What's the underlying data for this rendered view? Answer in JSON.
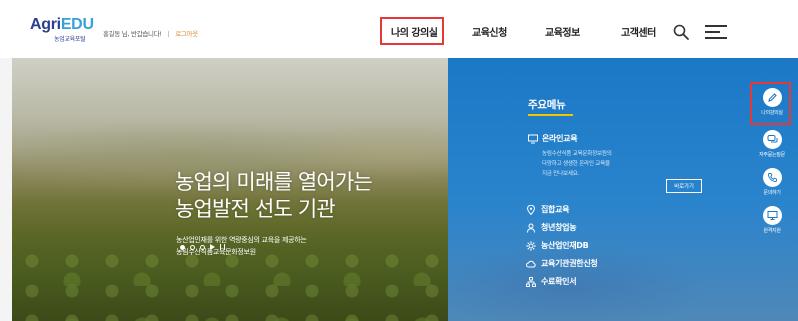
{
  "header": {
    "logo_main_a": "Agri",
    "logo_main_b": "EDU",
    "logo_sub": "농업교육포털",
    "greeting": "홍길동 님, 반갑습니다!",
    "separator": "|",
    "logout": "로그아웃"
  },
  "nav": {
    "items": [
      "나의 강의실",
      "교육신청",
      "교육정보",
      "고객센터"
    ],
    "icons": [
      "search-icon",
      "hamburger-menu-icon"
    ]
  },
  "hero": {
    "title_line1": "농업의 미래를 열어가는",
    "title_line2": "농업발전 선도 기관",
    "sub_line1": "농산업인재를 위한 역량중심의 교육을 제공하는",
    "sub_line2": "농림수산식품교육문화정보원",
    "slide_count": 3,
    "active_slide": 1
  },
  "main_menu": {
    "title": "주요메뉴",
    "online": {
      "label": "온라인교육",
      "desc_line1": "농림수산식품 교육문화정보원의",
      "desc_line2": "다양하고 생생한 온라인 교육을",
      "desc_line3": "지금 만나보세요.",
      "more": "바로가기"
    },
    "items": [
      {
        "label": "집합교육",
        "icon": "location-icon"
      },
      {
        "label": "청년창업농",
        "icon": "person-icon"
      },
      {
        "label": "농산업인재DB",
        "icon": "gear-icon"
      },
      {
        "label": "교육기관권한신청",
        "icon": "cloud-icon"
      },
      {
        "label": "수료확인서",
        "icon": "org-chart-icon"
      }
    ]
  },
  "quick_menu": {
    "items": [
      {
        "label": "나의강의실",
        "icon": "pencil-icon"
      },
      {
        "label": "자주묻는질문",
        "icon": "chat-icon"
      },
      {
        "label": "문의하기",
        "icon": "phone-icon"
      },
      {
        "label": "원격지원",
        "icon": "monitor-icon"
      }
    ]
  },
  "colors": {
    "brand_navy": "#2b3e8f",
    "brand_sky": "#3aa0d8",
    "panel_blue": "#1b78c6",
    "accent_yellow": "#f5c400",
    "highlight_red": "#e53935"
  }
}
